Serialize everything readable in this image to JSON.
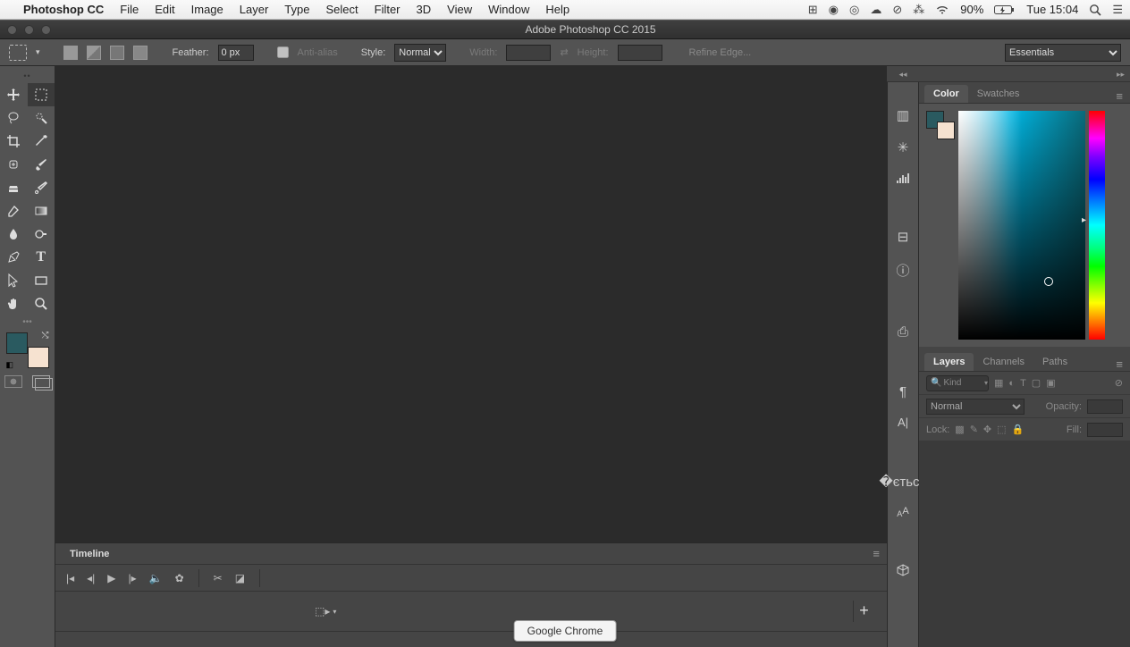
{
  "menubar": {
    "app": "Photoshop CC",
    "items": [
      "File",
      "Edit",
      "Image",
      "Layer",
      "Type",
      "Select",
      "Filter",
      "3D",
      "View",
      "Window",
      "Help"
    ],
    "battery": "90%",
    "clock": "Tue 15:04"
  },
  "window": {
    "title": "Adobe Photoshop CC 2015"
  },
  "options": {
    "feather_label": "Feather:",
    "feather_value": "0 px",
    "antialias_label": "Anti-alias",
    "style_label": "Style:",
    "style_value": "Normal",
    "width_label": "Width:",
    "height_label": "Height:",
    "refine_label": "Refine Edge...",
    "workspace": "Essentials"
  },
  "panels": {
    "color_tab": "Color",
    "swatches_tab": "Swatches",
    "layers_tab": "Layers",
    "channels_tab": "Channels",
    "paths_tab": "Paths",
    "timeline_tab": "Timeline",
    "kind_placeholder": "Kind",
    "blend_mode": "Normal",
    "opacity_label": "Opacity:",
    "lock_label": "Lock:",
    "fill_label": "Fill:"
  },
  "colors": {
    "foreground": "#2a5a60",
    "background": "#f6e2d0"
  },
  "dock": {
    "tooltip": "Google Chrome"
  }
}
